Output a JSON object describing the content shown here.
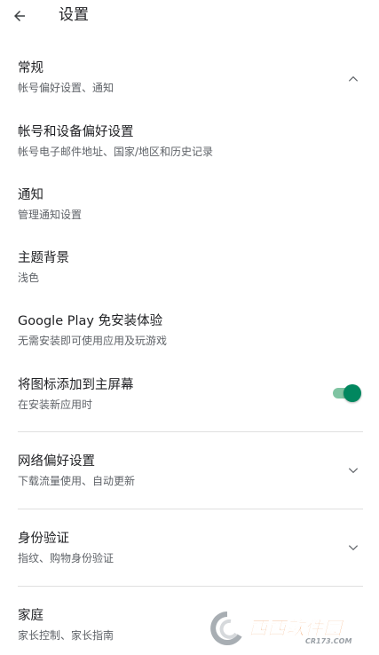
{
  "header": {
    "title": "设置",
    "back_icon": "arrow-left-icon"
  },
  "sections": {
    "general": {
      "title": "常规",
      "subtitle": "帐号偏好设置、通知",
      "expanded": true
    },
    "network": {
      "title": "网络偏好设置",
      "subtitle": "下载流量使用、自动更新",
      "expanded": false
    },
    "auth": {
      "title": "身份验证",
      "subtitle": "指纹、购物身份验证",
      "expanded": false
    },
    "family": {
      "title": "家庭",
      "subtitle": "家长控制、家长指南"
    }
  },
  "items": {
    "account": {
      "title": "帐号和设备偏好设置",
      "subtitle": "帐号电子邮件地址、国家/地区和历史记录"
    },
    "notifications": {
      "title": "通知",
      "subtitle": "管理通知设置"
    },
    "theme": {
      "title": "主题背景",
      "subtitle": "浅色"
    },
    "instant": {
      "title": "Google Play 免安装体验",
      "subtitle": "无需安装即可使用应用及玩游戏"
    },
    "add_icon": {
      "title": "将图标添加到主屏幕",
      "subtitle": "在安装新应用时",
      "toggle_on": true
    }
  },
  "watermark": {
    "brand": "西西软件园",
    "url": "CR173.COM"
  },
  "colors": {
    "accent": "#01875f",
    "accent_track": "#7fc4a2",
    "text_primary": "#202124",
    "text_secondary": "#5f6368",
    "divider": "#e0e0e0"
  }
}
